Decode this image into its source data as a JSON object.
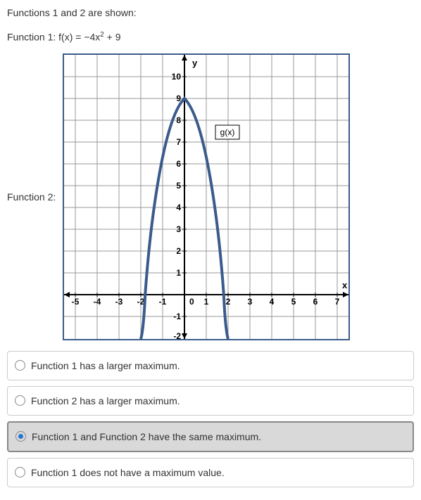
{
  "intro": "Functions 1 and 2 are shown:",
  "func1_label": "Function 1: f(x) = −4x² + 9",
  "func2_label": "Function 2:",
  "graph": {
    "y_label": "y",
    "x_label": "x",
    "curve_label": "g(x)",
    "x_ticks": [
      "-5",
      "-4",
      "-3",
      "-2",
      "-1",
      "0",
      "1",
      "2",
      "3",
      "4",
      "5",
      "6",
      "7"
    ],
    "y_ticks_pos": [
      "1",
      "2",
      "3",
      "4",
      "5",
      "6",
      "7",
      "8",
      "9",
      "10"
    ],
    "y_ticks_neg": [
      "-1",
      "-2"
    ]
  },
  "options": [
    {
      "label": "Function 1 has a larger maximum.",
      "selected": false
    },
    {
      "label": "Function 2 has a larger maximum.",
      "selected": false
    },
    {
      "label": "Function 1 and Function 2 have the same maximum.",
      "selected": true
    },
    {
      "label": "Function 1 does not have a maximum value.",
      "selected": false
    }
  ],
  "chart_data": {
    "type": "line",
    "title": "g(x)",
    "xlabel": "x",
    "ylabel": "y",
    "xlim": [
      -5,
      7
    ],
    "ylim": [
      -2,
      10
    ],
    "series": [
      {
        "name": "g(x)",
        "x": [
          -2,
          -1.8,
          -1.5,
          -1,
          -0.5,
          0,
          0.5,
          1,
          1.5,
          1.8,
          2
        ],
        "y": [
          -2,
          0,
          2.75,
          6,
          8.25,
          9,
          8.25,
          6,
          2.75,
          0,
          -2
        ]
      }
    ]
  }
}
